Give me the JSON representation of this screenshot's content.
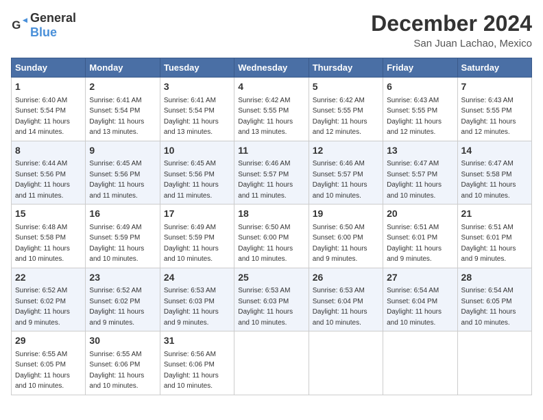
{
  "header": {
    "logo_general": "General",
    "logo_blue": "Blue",
    "month_year": "December 2024",
    "location": "San Juan Lachao, Mexico"
  },
  "weekdays": [
    "Sunday",
    "Monday",
    "Tuesday",
    "Wednesday",
    "Thursday",
    "Friday",
    "Saturday"
  ],
  "weeks": [
    [
      {
        "day": 1,
        "sunrise": "6:40 AM",
        "sunset": "5:54 PM",
        "daylight": "11 hours and 14 minutes."
      },
      {
        "day": 2,
        "sunrise": "6:41 AM",
        "sunset": "5:54 PM",
        "daylight": "11 hours and 13 minutes."
      },
      {
        "day": 3,
        "sunrise": "6:41 AM",
        "sunset": "5:54 PM",
        "daylight": "11 hours and 13 minutes."
      },
      {
        "day": 4,
        "sunrise": "6:42 AM",
        "sunset": "5:55 PM",
        "daylight": "11 hours and 13 minutes."
      },
      {
        "day": 5,
        "sunrise": "6:42 AM",
        "sunset": "5:55 PM",
        "daylight": "11 hours and 12 minutes."
      },
      {
        "day": 6,
        "sunrise": "6:43 AM",
        "sunset": "5:55 PM",
        "daylight": "11 hours and 12 minutes."
      },
      {
        "day": 7,
        "sunrise": "6:43 AM",
        "sunset": "5:55 PM",
        "daylight": "11 hours and 12 minutes."
      }
    ],
    [
      {
        "day": 8,
        "sunrise": "6:44 AM",
        "sunset": "5:56 PM",
        "daylight": "11 hours and 11 minutes."
      },
      {
        "day": 9,
        "sunrise": "6:45 AM",
        "sunset": "5:56 PM",
        "daylight": "11 hours and 11 minutes."
      },
      {
        "day": 10,
        "sunrise": "6:45 AM",
        "sunset": "5:56 PM",
        "daylight": "11 hours and 11 minutes."
      },
      {
        "day": 11,
        "sunrise": "6:46 AM",
        "sunset": "5:57 PM",
        "daylight": "11 hours and 11 minutes."
      },
      {
        "day": 12,
        "sunrise": "6:46 AM",
        "sunset": "5:57 PM",
        "daylight": "11 hours and 10 minutes."
      },
      {
        "day": 13,
        "sunrise": "6:47 AM",
        "sunset": "5:57 PM",
        "daylight": "11 hours and 10 minutes."
      },
      {
        "day": 14,
        "sunrise": "6:47 AM",
        "sunset": "5:58 PM",
        "daylight": "11 hours and 10 minutes."
      }
    ],
    [
      {
        "day": 15,
        "sunrise": "6:48 AM",
        "sunset": "5:58 PM",
        "daylight": "11 hours and 10 minutes."
      },
      {
        "day": 16,
        "sunrise": "6:49 AM",
        "sunset": "5:59 PM",
        "daylight": "11 hours and 10 minutes."
      },
      {
        "day": 17,
        "sunrise": "6:49 AM",
        "sunset": "5:59 PM",
        "daylight": "11 hours and 10 minutes."
      },
      {
        "day": 18,
        "sunrise": "6:50 AM",
        "sunset": "6:00 PM",
        "daylight": "11 hours and 10 minutes."
      },
      {
        "day": 19,
        "sunrise": "6:50 AM",
        "sunset": "6:00 PM",
        "daylight": "11 hours and 9 minutes."
      },
      {
        "day": 20,
        "sunrise": "6:51 AM",
        "sunset": "6:01 PM",
        "daylight": "11 hours and 9 minutes."
      },
      {
        "day": 21,
        "sunrise": "6:51 AM",
        "sunset": "6:01 PM",
        "daylight": "11 hours and 9 minutes."
      }
    ],
    [
      {
        "day": 22,
        "sunrise": "6:52 AM",
        "sunset": "6:02 PM",
        "daylight": "11 hours and 9 minutes."
      },
      {
        "day": 23,
        "sunrise": "6:52 AM",
        "sunset": "6:02 PM",
        "daylight": "11 hours and 9 minutes."
      },
      {
        "day": 24,
        "sunrise": "6:53 AM",
        "sunset": "6:03 PM",
        "daylight": "11 hours and 9 minutes."
      },
      {
        "day": 25,
        "sunrise": "6:53 AM",
        "sunset": "6:03 PM",
        "daylight": "11 hours and 10 minutes."
      },
      {
        "day": 26,
        "sunrise": "6:53 AM",
        "sunset": "6:04 PM",
        "daylight": "11 hours and 10 minutes."
      },
      {
        "day": 27,
        "sunrise": "6:54 AM",
        "sunset": "6:04 PM",
        "daylight": "11 hours and 10 minutes."
      },
      {
        "day": 28,
        "sunrise": "6:54 AM",
        "sunset": "6:05 PM",
        "daylight": "11 hours and 10 minutes."
      }
    ],
    [
      {
        "day": 29,
        "sunrise": "6:55 AM",
        "sunset": "6:05 PM",
        "daylight": "11 hours and 10 minutes."
      },
      {
        "day": 30,
        "sunrise": "6:55 AM",
        "sunset": "6:06 PM",
        "daylight": "11 hours and 10 minutes."
      },
      {
        "day": 31,
        "sunrise": "6:56 AM",
        "sunset": "6:06 PM",
        "daylight": "11 hours and 10 minutes."
      },
      null,
      null,
      null,
      null
    ]
  ]
}
